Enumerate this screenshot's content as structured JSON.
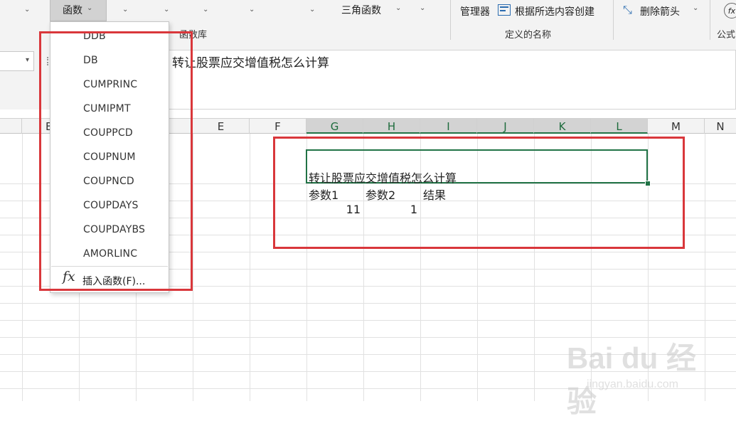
{
  "ribbon": {
    "functions_button_label": "函数",
    "trig_button_label": "三角函数",
    "function_library_group": "函数库",
    "name_manager_label": "管理器",
    "create_from_selection_label": "根据所选内容创建",
    "defined_names_group": "定义的名称",
    "remove_arrows_label": "删除箭头",
    "formulas_group_partial": "公式"
  },
  "formula_bar": {
    "content": "转让股票应交增值税怎么计算"
  },
  "columns": [
    "E",
    "F",
    "G",
    "H",
    "I",
    "J",
    "K",
    "L",
    "M",
    "N"
  ],
  "column_partial": "E",
  "selected_columns": [
    "G",
    "H",
    "I",
    "J",
    "K",
    "L"
  ],
  "cells": {
    "title": "转让股票应交增值税怎么计算",
    "header_param1": "参数1",
    "header_param2": "参数2",
    "header_result": "结果",
    "value_param1": "11",
    "value_param2": "1"
  },
  "dropdown": {
    "items": [
      "DDB",
      "DB",
      "CUMPRINC",
      "CUMIPMT",
      "COUPPCD",
      "COUPNUM",
      "COUPNCD",
      "COUPDAYS",
      "COUPDAYBS",
      "AMORLINC"
    ],
    "insert_function_label": "插入函数(F)...",
    "fx_symbol": "fx"
  },
  "watermark": {
    "logo": "Bai du 经验",
    "url": "jingyan.baidu.com"
  },
  "colors": {
    "accent_green": "#217346",
    "annotation_red": "#d9373b"
  }
}
